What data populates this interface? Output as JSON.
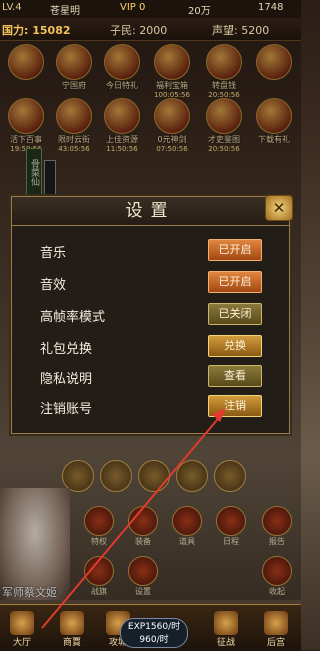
{
  "topbar": {
    "level": "LV.4",
    "name": "苍星明",
    "vip": "VIP 0",
    "silver": "20万",
    "gold": "1748"
  },
  "stats": {
    "power": "国力: 15082",
    "people": "子民: 2000",
    "prestige": "声望: 5200"
  },
  "events_row1": [
    {
      "label": "",
      "time": ""
    },
    {
      "label": "宁国府",
      "time": ""
    },
    {
      "label": "今日特礼",
      "time": ""
    },
    {
      "label": "福利宝箱",
      "time": "100:05:56"
    },
    {
      "label": "转盘钱",
      "time": "20:50:56"
    },
    {
      "label": "",
      "time": ""
    }
  ],
  "events_row2": [
    {
      "label": "活下百事",
      "time": "19:50:56"
    },
    {
      "label": "限时云街",
      "time": "43:05:56"
    },
    {
      "label": "上佳资源",
      "time": "11:50:56"
    },
    {
      "label": "0元神剑",
      "time": "07:50:56"
    },
    {
      "label": "才吏鉴图",
      "time": "20:50:56"
    },
    {
      "label": "下载有礼",
      "time": ""
    }
  ],
  "vertical_tag": "骨菜仙",
  "dialog": {
    "title": "设置",
    "close_icon": "close-icon",
    "rows": [
      {
        "label": "音乐",
        "button": "已开启",
        "state": "on"
      },
      {
        "label": "音效",
        "button": "已开启",
        "state": "on"
      },
      {
        "label": "高帧率模式",
        "button": "已关闭",
        "state": "off"
      },
      {
        "label": "礼包兑换",
        "button": "兑换",
        "state": "gold"
      },
      {
        "label": "隐私说明",
        "button": "查看",
        "state": "off"
      },
      {
        "label": "注销账号",
        "button": "注销",
        "state": "gold"
      }
    ]
  },
  "side_menu": [
    {
      "label": "特权"
    },
    {
      "label": "装备"
    },
    {
      "label": "道具"
    },
    {
      "label": "日程"
    },
    {
      "label": "报告"
    },
    {
      "label": "战旗"
    },
    {
      "label": "设置"
    },
    {
      "label": "收起"
    }
  ],
  "portrait_label": "军师蔡文姬",
  "bottom_bar": [
    {
      "label": "大厅"
    },
    {
      "label": "商賈"
    },
    {
      "label": "攻城"
    },
    {
      "label": "征战"
    },
    {
      "label": "后宫"
    }
  ],
  "exp": {
    "line1": "EXP1560/时",
    "line2": "960/时"
  },
  "colors": {
    "accent_on": "#c9622a",
    "accent_gold": "#c58a2b",
    "arrow": "#e23b2e"
  }
}
